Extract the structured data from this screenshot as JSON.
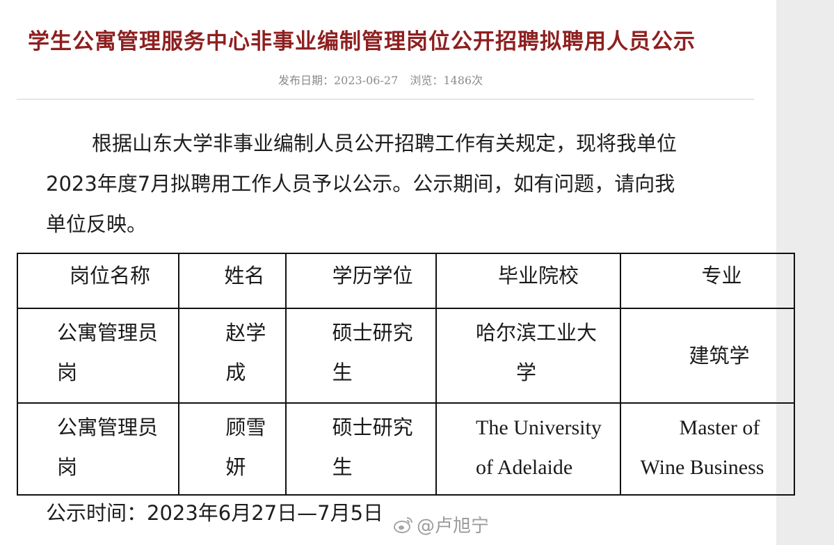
{
  "notice": {
    "title": "学生公寓管理服务中心非事业编制管理岗位公开招聘拟聘用人员公示",
    "publish_label": "发布日期：2023-06-27",
    "views_label": "浏览：1486次",
    "paragraph_lines": [
      "根据山东大学非事业编制人员公开招聘工作有关规定，现将我单位",
      "2023年度7月拟聘用工作人员予以公示。公示期间，如有问题，请向我",
      "单位反映。"
    ],
    "table": {
      "headers": [
        "岗位名称",
        "姓名",
        "学历学位",
        "毕业院校",
        "专业"
      ],
      "rows": [
        {
          "position": [
            "公寓管理员",
            "岗"
          ],
          "name": [
            "赵学",
            "成"
          ],
          "degree": [
            "硕士研究",
            "生"
          ],
          "school": [
            "哈尔滨工业大",
            "学"
          ],
          "major": [
            "建筑学"
          ]
        },
        {
          "position": [
            "公寓管理员",
            "岗"
          ],
          "name": [
            "顾雪",
            "妍"
          ],
          "degree": [
            "硕士研究",
            "生"
          ],
          "school": [
            "The University",
            "of Adelaide"
          ],
          "major": [
            "Master of",
            "Wine Business"
          ]
        }
      ]
    },
    "footer": "公示时间：2023年6月27日—7月5日",
    "watermark": "@卢旭宁",
    "watermark_icon": "weibo-icon"
  }
}
